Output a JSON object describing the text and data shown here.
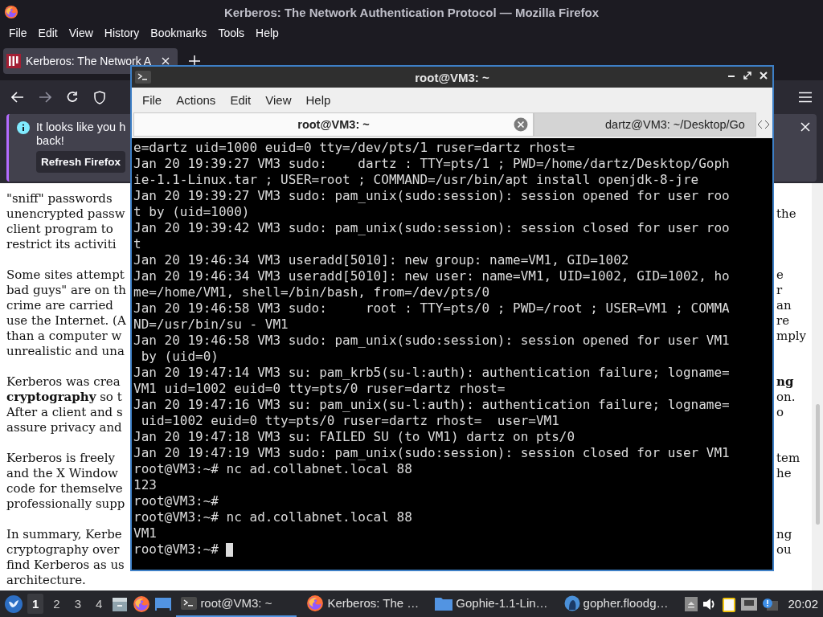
{
  "browser": {
    "title": "Kerberos: The Network Authentication Protocol — Mozilla Firefox",
    "menu": [
      "File",
      "Edit",
      "View",
      "History",
      "Bookmarks",
      "Tools",
      "Help"
    ],
    "tabs": [
      {
        "label": "Kerberos: The Network A",
        "selected": true
      }
    ],
    "notification": {
      "text_lines": [
        "It looks like you h",
        "back!"
      ],
      "button": "Refresh Firefox"
    },
    "article": {
      "paragraphs": [
        {
          "lines": [
            {
              "left": "\"sniff\" passwords"
            },
            {
              "left": "unencrypted passw",
              "right": "the"
            },
            {
              "left": "client program to"
            },
            {
              "left": "restrict its activiti"
            }
          ]
        },
        {
          "lines": [
            {
              "left": "Some sites attempt",
              "right": "e"
            },
            {
              "left": "bad guys\" are on th",
              "right": "r"
            },
            {
              "left": "crime are carried",
              "right": "an"
            },
            {
              "left": "use the Internet. (A",
              "right": "re"
            },
            {
              "left": "than a computer w",
              "right": "mply"
            },
            {
              "left": "unrealistic and una"
            }
          ]
        },
        {
          "lines": [
            {
              "left": "Kerberos was crea",
              "right": "**ng**"
            },
            {
              "left": "**cryptography** so t",
              "right": "on."
            },
            {
              "left": "After a client and s",
              "right": "o"
            },
            {
              "left": "assure privacy and"
            }
          ]
        },
        {
          "lines": [
            {
              "left": "Kerberos is freely",
              "right": "tem"
            },
            {
              "left": "and the X Window",
              "right": "he"
            },
            {
              "left": "code for themselve"
            },
            {
              "left": "professionally supp"
            }
          ]
        },
        {
          "lines": [
            {
              "left": "In summary, Kerbe",
              "right": "ng"
            },
            {
              "left": "cryptography over",
              "right": "ou"
            },
            {
              "left": "find Kerberos as us"
            },
            {
              "left": "architecture."
            }
          ]
        }
      ]
    }
  },
  "terminal": {
    "title": "root@VM3: ~",
    "menu": [
      "File",
      "Actions",
      "Edit",
      "View",
      "Help"
    ],
    "tabs": [
      {
        "label": "root@VM3: ~",
        "selected": true
      },
      {
        "label": "dartz@VM3: ~/Desktop/Go",
        "selected": false
      }
    ],
    "lines": [
      "e=dartz uid=1000 euid=0 tty=/dev/pts/1 ruser=dartz rhost=",
      "Jan 20 19:39:27 VM3 sudo:    dartz : TTY=pts/1 ; PWD=/home/dartz/Desktop/Goph",
      "ie-1.1-Linux.tar ; USER=root ; COMMAND=/usr/bin/apt install openjdk-8-jre",
      "Jan 20 19:39:27 VM3 sudo: pam_unix(sudo:session): session opened for user roo",
      "t by (uid=1000)",
      "Jan 20 19:39:42 VM3 sudo: pam_unix(sudo:session): session closed for user roo",
      "t",
      "Jan 20 19:46:34 VM3 useradd[5010]: new group: name=VM1, GID=1002",
      "Jan 20 19:46:34 VM3 useradd[5010]: new user: name=VM1, UID=1002, GID=1002, ho",
      "me=/home/VM1, shell=/bin/bash, from=/dev/pts/0",
      "Jan 20 19:46:58 VM3 sudo:     root : TTY=pts/0 ; PWD=/root ; USER=VM1 ; COMMA",
      "ND=/usr/bin/su - VM1",
      "Jan 20 19:46:58 VM3 sudo: pam_unix(sudo:session): session opened for user VM1",
      " by (uid=0)",
      "Jan 20 19:47:14 VM3 su: pam_krb5(su-l:auth): authentication failure; logname=",
      "VM1 uid=1002 euid=0 tty=pts/0 ruser=dartz rhost=",
      "Jan 20 19:47:16 VM3 su: pam_unix(su-l:auth): authentication failure; logname=",
      " uid=1002 euid=0 tty=pts/0 ruser=dartz rhost=  user=VM1",
      "Jan 20 19:47:18 VM3 su: FAILED SU (to VM1) dartz on pts/0",
      "Jan 20 19:47:19 VM3 sudo: pam_unix(sudo:session): session closed for user VM1",
      "root@VM3:~# nc ad.collabnet.local 88",
      "123",
      "root@VM3:~#",
      "root@VM3:~# nc ad.collabnet.local 88",
      "VM1",
      "root@VM3:~#"
    ]
  },
  "taskbar": {
    "workspaces": [
      {
        "label": "1",
        "selected": true
      },
      {
        "label": "2",
        "selected": false
      },
      {
        "label": "3",
        "selected": false
      },
      {
        "label": "4",
        "selected": false
      }
    ],
    "tasks": [
      {
        "kind": "terminal",
        "label": "root@VM3: ~",
        "selected": true
      },
      {
        "kind": "firefox",
        "label": "Kerberos: The …",
        "selected": false
      },
      {
        "kind": "folder",
        "label": "Gophie-1.1-Lin…",
        "selected": false
      },
      {
        "kind": "gopher",
        "label": "gopher.floodg…",
        "selected": false
      }
    ],
    "clock": "20:02"
  }
}
